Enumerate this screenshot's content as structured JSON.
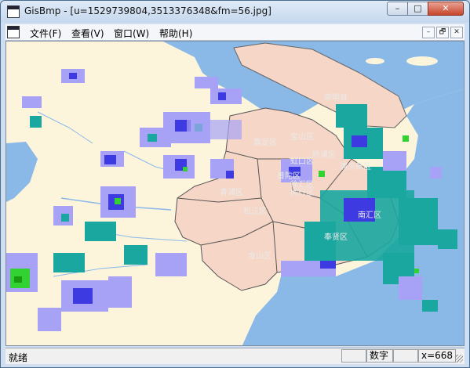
{
  "window": {
    "title": "GisBmp - [u=1529739804,3513376348&fm=56.jpg]"
  },
  "window_buttons": {
    "minimize": "–",
    "maximize": "□",
    "close": "✕"
  },
  "mdi_buttons": {
    "minimize": "–",
    "restore": "🗗",
    "close": "✕"
  },
  "menu": [
    {
      "label": "文件(F)"
    },
    {
      "label": "查看(V)"
    },
    {
      "label": "窗口(W)"
    },
    {
      "label": "帮助(H)"
    }
  ],
  "map": {
    "labels": [
      "崇明县",
      "宝山区",
      "嘉定区",
      "杨浦区",
      "虹口区",
      "浦东新区",
      "普陀区",
      "青浦区",
      "闵行区",
      "松江区",
      "徐汇区",
      "金山区",
      "南汇区",
      "奉贤区"
    ],
    "colors": {
      "land": "#fcf5dc",
      "water": "#8ab9e8",
      "district": "#f6d6c6",
      "radar_light": "#a7a2f5",
      "radar_blue": "#3c3ae0",
      "radar_teal": "#1aa7a0",
      "radar_green": "#32d232"
    }
  },
  "status": {
    "ready": "就绪",
    "caps": "",
    "num": "数字",
    "scrl": "",
    "coord": "x=668"
  }
}
